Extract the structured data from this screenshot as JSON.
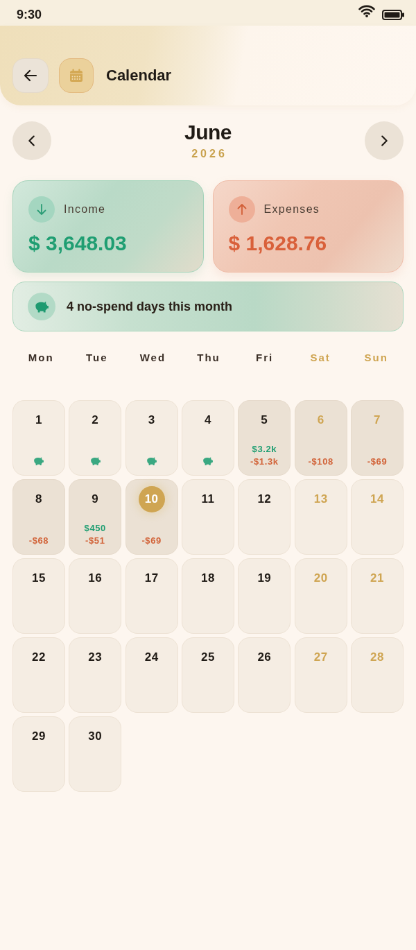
{
  "status_bar": {
    "time": "9:30"
  },
  "app_bar": {
    "title": "Calendar"
  },
  "month_nav": {
    "month": "June",
    "year": "2026"
  },
  "summary": [
    {
      "kind": "income",
      "label": "Income",
      "amount": "$ 3,648.03"
    },
    {
      "kind": "expense",
      "label": "Expenses",
      "amount": "$ 1,628.76"
    }
  ],
  "no_spend_banner": {
    "text": "4 no-spend days this month"
  },
  "weekdays": [
    {
      "label": "Mon",
      "weekend": false
    },
    {
      "label": "Tue",
      "weekend": false
    },
    {
      "label": "Wed",
      "weekend": false
    },
    {
      "label": "Thu",
      "weekend": false
    },
    {
      "label": "Fri",
      "weekend": false
    },
    {
      "label": "Sat",
      "weekend": true
    },
    {
      "label": "Sun",
      "weekend": true
    }
  ],
  "days": [
    {
      "day": "1",
      "weekend": false,
      "selected": false,
      "no_spend": true
    },
    {
      "day": "2",
      "weekend": false,
      "selected": false,
      "no_spend": true
    },
    {
      "day": "3",
      "weekend": false,
      "selected": false,
      "no_spend": true
    },
    {
      "day": "4",
      "weekend": false,
      "selected": false,
      "no_spend": true
    },
    {
      "day": "5",
      "weekend": false,
      "selected": false,
      "no_spend": false,
      "income": "$3.2k",
      "expense": "-$1.3k"
    },
    {
      "day": "6",
      "weekend": true,
      "selected": false,
      "no_spend": false,
      "expense": "-$108"
    },
    {
      "day": "7",
      "weekend": true,
      "selected": false,
      "no_spend": false,
      "expense": "-$69"
    },
    {
      "day": "8",
      "weekend": false,
      "selected": false,
      "no_spend": false,
      "expense": "-$68"
    },
    {
      "day": "9",
      "weekend": false,
      "selected": false,
      "no_spend": false,
      "income": "$450",
      "expense": "-$51"
    },
    {
      "day": "10",
      "weekend": false,
      "selected": true,
      "no_spend": false,
      "expense": "-$69"
    },
    {
      "day": "11",
      "weekend": false,
      "selected": false,
      "no_spend": false
    },
    {
      "day": "12",
      "weekend": false,
      "selected": false,
      "no_spend": false
    },
    {
      "day": "13",
      "weekend": true,
      "selected": false,
      "no_spend": false
    },
    {
      "day": "14",
      "weekend": true,
      "selected": false,
      "no_spend": false
    },
    {
      "day": "15",
      "weekend": false,
      "selected": false,
      "no_spend": false
    },
    {
      "day": "16",
      "weekend": false,
      "selected": false,
      "no_spend": false
    },
    {
      "day": "17",
      "weekend": false,
      "selected": false,
      "no_spend": false
    },
    {
      "day": "18",
      "weekend": false,
      "selected": false,
      "no_spend": false
    },
    {
      "day": "19",
      "weekend": false,
      "selected": false,
      "no_spend": false
    },
    {
      "day": "20",
      "weekend": true,
      "selected": false,
      "no_spend": false
    },
    {
      "day": "21",
      "weekend": true,
      "selected": false,
      "no_spend": false
    },
    {
      "day": "22",
      "weekend": false,
      "selected": false,
      "no_spend": false
    },
    {
      "day": "23",
      "weekend": false,
      "selected": false,
      "no_spend": false
    },
    {
      "day": "24",
      "weekend": false,
      "selected": false,
      "no_spend": false
    },
    {
      "day": "25",
      "weekend": false,
      "selected": false,
      "no_spend": false
    },
    {
      "day": "26",
      "weekend": false,
      "selected": false,
      "no_spend": false
    },
    {
      "day": "27",
      "weekend": true,
      "selected": false,
      "no_spend": false
    },
    {
      "day": "28",
      "weekend": true,
      "selected": false,
      "no_spend": false
    },
    {
      "day": "29",
      "weekend": false,
      "selected": false,
      "no_spend": false
    },
    {
      "day": "30",
      "weekend": false,
      "selected": false,
      "no_spend": false
    }
  ]
}
